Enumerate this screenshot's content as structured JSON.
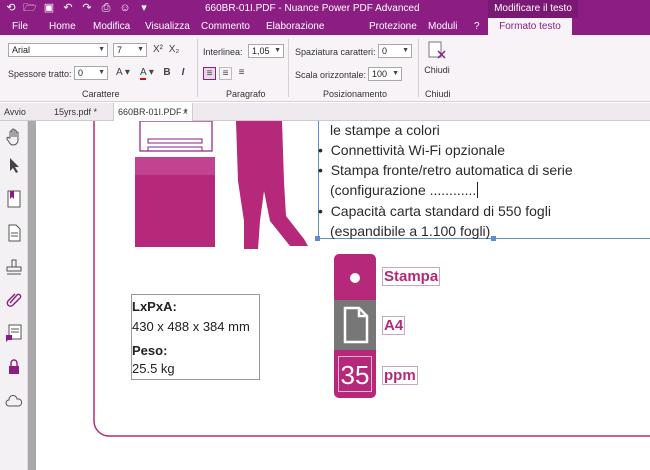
{
  "titlebar": {
    "title": "660BR-01I.PDF - Nuance Power PDF Advanced",
    "context_tab": "Modificare il testo"
  },
  "menu": {
    "items": [
      "File",
      "Home",
      "Modifica",
      "Visualizza",
      "Commento",
      "Elaborazione avanzata",
      "Protezione",
      "Moduli",
      "?",
      "Formato testo"
    ]
  },
  "ribbon": {
    "font": "Arial",
    "font_size": "7",
    "stroke_label": "Spessore tratto:",
    "stroke_value": "0",
    "interline_label": "Interlinea:",
    "interline_value": "1,05",
    "char_spacing_label": "Spaziatura caratteri:",
    "char_spacing_value": "0",
    "horiz_scale_label": "Scala orizzontale:",
    "horiz_scale_value": "100",
    "close_label": "Chiudi",
    "groups": {
      "caratteri": "Carattere",
      "paragrafo": "Paragrafo",
      "posizionamento": "Posizionamento",
      "chiudi": "Chiudi"
    }
  },
  "tabs": [
    {
      "label": "Avvio"
    },
    {
      "label": "15yrs.pdf *"
    },
    {
      "label": "660BR-01I.PDF *"
    }
  ],
  "doc": {
    "lines": [
      "le stampe a colori",
      "Connettività Wi-Fi opzionale",
      "Stampa fronte/retro automatica di serie",
      "(configurazione ............",
      "Capacità carta standard di 550 fogli",
      "(espandibile a 1.100 fogli)"
    ],
    "dims_label": "LxPxA:",
    "dims_value": "430 x 488 x 384 mm",
    "weight_label": "Peso:",
    "weight_value": "25.5 kg",
    "feature_print": "Stampa",
    "feature_paper": "A4",
    "speed_number": "35",
    "speed_unit": "ppm"
  }
}
